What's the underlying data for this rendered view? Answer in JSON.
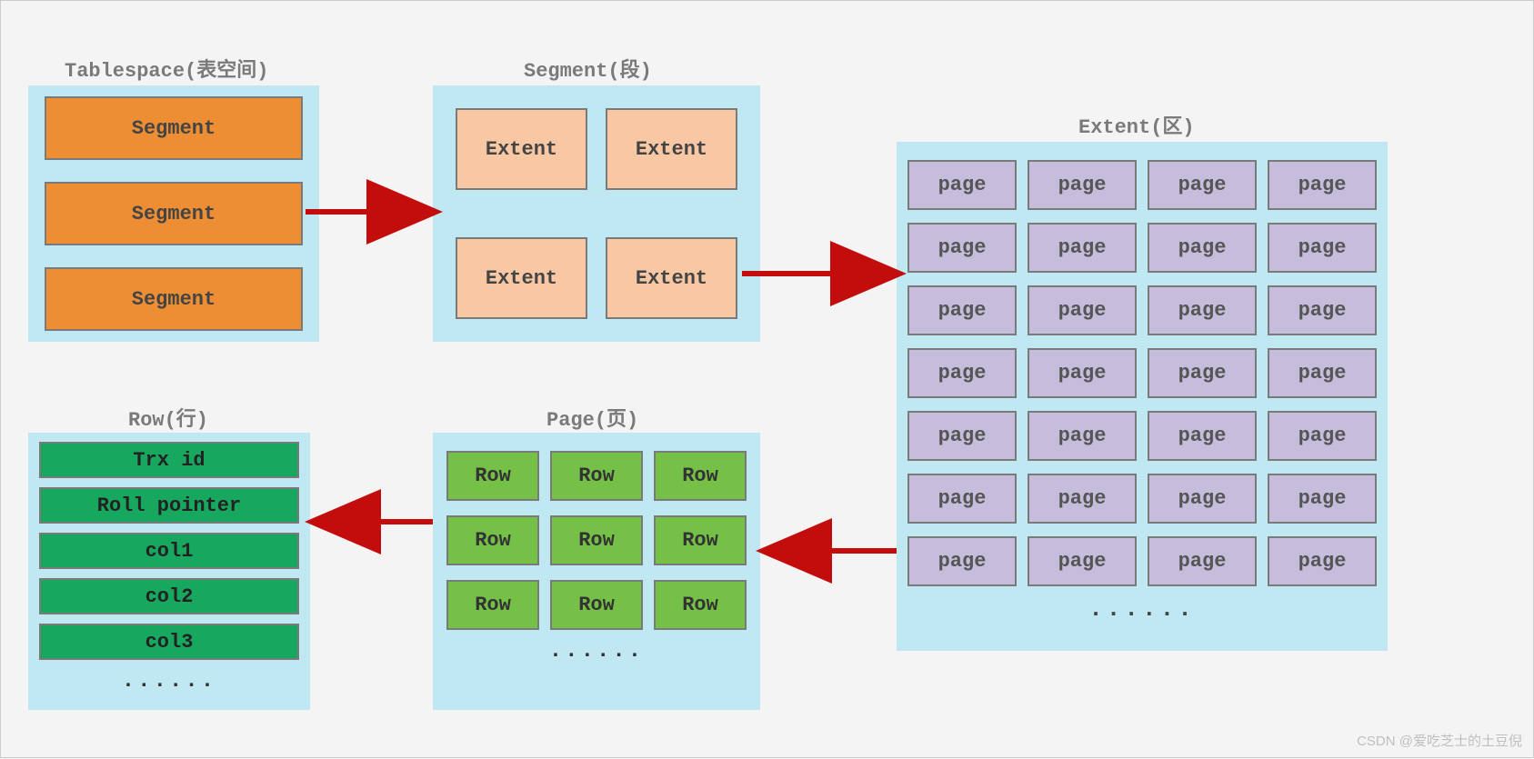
{
  "titles": {
    "tablespace": "Tablespace(表空间)",
    "segment": "Segment(段)",
    "extent": "Extent(区)",
    "page": "Page(页)",
    "row": "Row(行)"
  },
  "tablespace": {
    "items": [
      "Segment",
      "Segment",
      "Segment"
    ]
  },
  "segment": {
    "items": [
      "Extent",
      "Extent",
      "Extent",
      "Extent"
    ]
  },
  "extent": {
    "cell_label": "page",
    "rows": 7,
    "cols": 4,
    "more": "......"
  },
  "page": {
    "cell_label": "Row",
    "rows": 3,
    "cols": 3,
    "more": "......"
  },
  "row": {
    "fields": [
      "Trx id",
      "Roll pointer",
      "col1",
      "col2",
      "col3"
    ],
    "more": "......"
  },
  "arrow_color": "#C30D0D",
  "watermark": "CSDN @爱吃芝士的土豆倪"
}
